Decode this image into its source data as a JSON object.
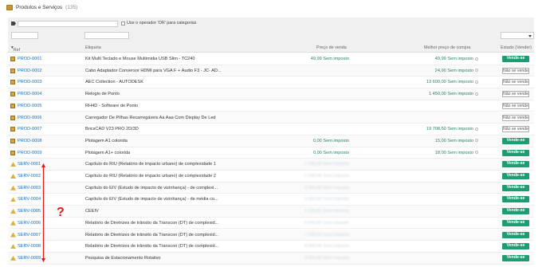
{
  "header": {
    "title": "Produtos e Serviços",
    "count": "(135)"
  },
  "filters": {
    "or_operator_label": "Use o operador 'OR' para categorias"
  },
  "columns": {
    "ref": "Ref",
    "label": "Etiqueta",
    "price": "Preço de venda",
    "best_price": "Melhor preço de compra",
    "state": "Estado (Vender)"
  },
  "rows": [
    {
      "ref": "PROD-0001",
      "label": "Kit Multi Teclado e Mouse Multimidia USB Slim - TC240",
      "price": "49,99 Sem imposto",
      "best": "49,99 Sem imposto",
      "state": "Vende-se",
      "type": "prod"
    },
    {
      "ref": "PROD-0002",
      "label": "Cabo Adaptador Conversor HDMI para VGA F + Áudio F3 - JC- AD...",
      "price": "",
      "best": "24,90 Sem imposto",
      "state": "Não se vende",
      "type": "prod"
    },
    {
      "ref": "PROD-0003",
      "label": "AEC Collection - AUTODESK",
      "price": "",
      "best": "13 600,00 Sem imposto",
      "state": "Não se vende",
      "type": "prod"
    },
    {
      "ref": "PROD-0004",
      "label": "Relogio de Ponto",
      "price": "",
      "best": "1 450,00 Sem imposto",
      "state": "Não se vende",
      "type": "prod"
    },
    {
      "ref": "PROD-0005",
      "label": "RH4D - Software de Ponto",
      "price": "",
      "best": "",
      "state": "Não se vende",
      "type": "prod"
    },
    {
      "ref": "PROD-0006",
      "label": "Carregador De Pilhas Recarregáveis Aa Aaa Com Display De Led",
      "price": "",
      "best": "",
      "state": "Não se vende",
      "type": "prod"
    },
    {
      "ref": "PROD-0007",
      "label": "BricsCAD V23 PRO 2D/3D",
      "price": "",
      "best": "19 708,50 Sem imposto",
      "state": "Não se vende",
      "type": "prod"
    },
    {
      "ref": "PROD-0008",
      "label": "Plotagem A1 colorida",
      "price": "0,00 Sem imposto",
      "best": "15,00 Sem imposto",
      "state": "Vende-se",
      "type": "prod"
    },
    {
      "ref": "PROD-0009",
      "label": "Plotagem A1+ colorida",
      "price": "0,00 Sem imposto",
      "best": "18,00 Sem imposto",
      "state": "Vende-se",
      "type": "prod"
    },
    {
      "ref": "SERV-0001",
      "label": "Capítulo do RIU (Relatório de impacto urbano) de complexidade 1",
      "price": "1 100,00 Sem imposto",
      "best": "",
      "state": "Vende-se",
      "type": "serv",
      "blur": true
    },
    {
      "ref": "SERV-0002",
      "label": "Capítulo do RIU (Relatório de impacto urbano) de complexidade 2",
      "price": "2 200,00 Sem imposto",
      "best": "",
      "state": "Vende-se",
      "type": "serv",
      "blur": true
    },
    {
      "ref": "SERV-0003",
      "label": "Capítulo do EIV (Estudo de impacto de vizinhança) - de complexi...",
      "price": "3 300,00 Sem imposto",
      "best": "",
      "state": "Vende-se",
      "type": "serv",
      "blur": true
    },
    {
      "ref": "SERV-0004",
      "label": "Capítulo do EIV (Estudo de impacto de vizinhança) - de média co...",
      "price": "4 400,00 Sem imposto",
      "best": "",
      "state": "Vende-se",
      "type": "serv",
      "blur": true
    },
    {
      "ref": "SERV-0005",
      "label": "CEEIV",
      "price": "5 500,00 Sem imposto",
      "best": "",
      "state": "Vende-se",
      "type": "serv",
      "blur": true
    },
    {
      "ref": "SERV-0006",
      "label": "Relatório de Diretrizes de trânsito da Transcon (DT) de complexid...",
      "price": "6 600,00 Sem imposto",
      "best": "",
      "state": "Vende-se",
      "type": "serv",
      "blur": true
    },
    {
      "ref": "SERV-0007",
      "label": "Relatório de Diretrizes de trânsito da Transcon (DT) de complexid...",
      "price": "7 700,00 Sem imposto",
      "best": "",
      "state": "Vende-se",
      "type": "serv",
      "blur": true
    },
    {
      "ref": "SERV-0008",
      "label": "Relatório de Diretrizes de trânsito da Transcon (DT) de complexid...",
      "price": "8 800,00 Sem imposto",
      "best": "",
      "state": "Vende-se",
      "type": "serv",
      "blur": true
    },
    {
      "ref": "SERV-0009",
      "label": "Pesquisa de Estacionamento Rotativo",
      "price": "9 900,00 Sem imposto",
      "best": "",
      "state": "Vende-se",
      "type": "serv",
      "blur": true
    }
  ],
  "annotation": {
    "mark": "?",
    "color": "#d81b1b"
  }
}
